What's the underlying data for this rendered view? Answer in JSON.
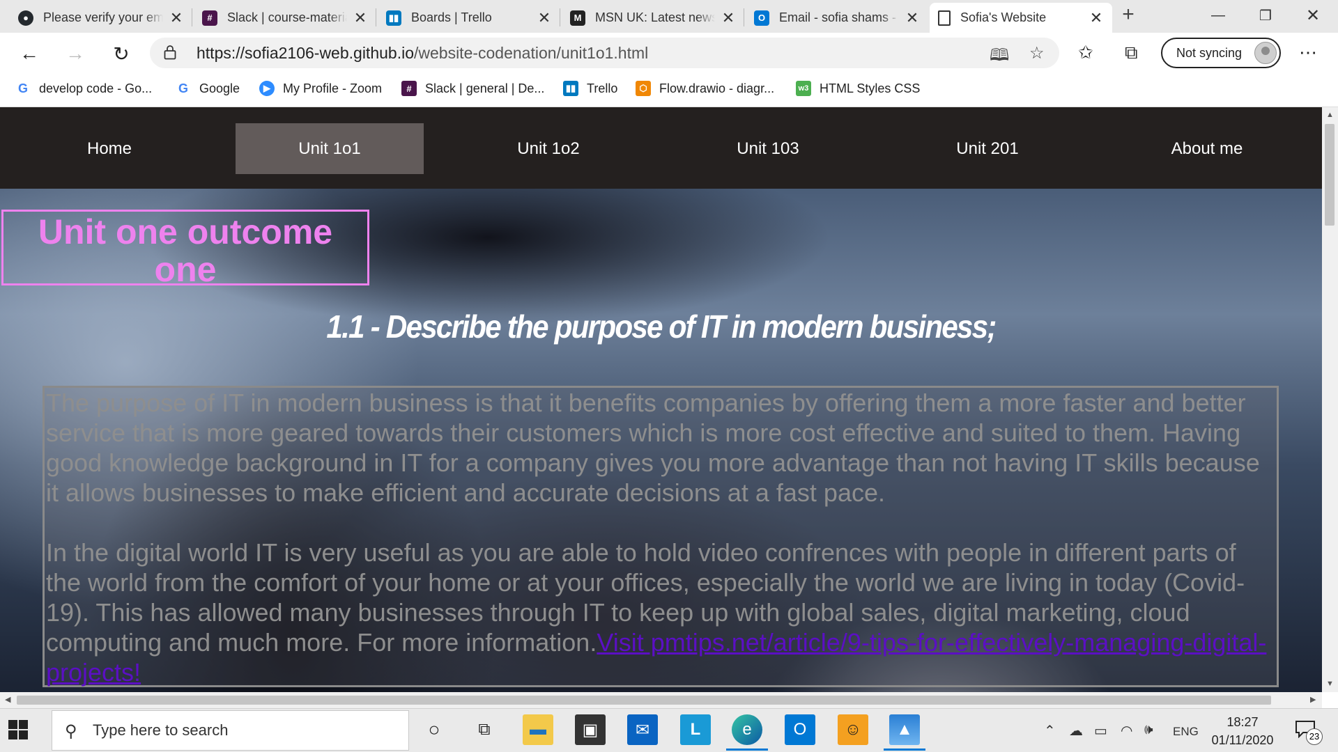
{
  "browser": {
    "tabs": [
      {
        "title": "Please verify your email",
        "icon": "github-icon",
        "favcolor": "#24292e",
        "glyph": "●"
      },
      {
        "title": "Slack | course-materials",
        "icon": "slack-icon",
        "favcolor": "#4a154b",
        "glyph": "#"
      },
      {
        "title": "Boards | Trello",
        "icon": "trello-icon",
        "favcolor": "#0079bf",
        "glyph": "▮"
      },
      {
        "title": "MSN UK: Latest news",
        "icon": "msn-icon",
        "favcolor": "#222222",
        "glyph": "M"
      },
      {
        "title": "Email - sofia shams - Outlook",
        "icon": "outlook-icon",
        "favcolor": "#0078d4",
        "glyph": "O"
      },
      {
        "title": "Sofia's Website",
        "icon": "page-icon",
        "favcolor": "#ffffff",
        "glyph": "🗋",
        "active": true
      }
    ],
    "url_host": "https://sofia2106-web.github.io",
    "url_path": "/website-codenation/unit1o1.html",
    "sync_label": "Not syncing",
    "favorites": [
      {
        "label": "develop code - Go...",
        "icon": "google-icon",
        "favcolor": "#4285f4",
        "glyph": "G"
      },
      {
        "label": "Google",
        "icon": "google-icon",
        "favcolor": "#4285f4",
        "glyph": "G"
      },
      {
        "label": "My Profile - Zoom",
        "icon": "zoom-icon",
        "favcolor": "#2d8cff",
        "glyph": "▶"
      },
      {
        "label": "Slack | general | De...",
        "icon": "slack-icon",
        "favcolor": "#4a154b",
        "glyph": "#"
      },
      {
        "label": "Trello",
        "icon": "trello-icon",
        "favcolor": "#0079bf",
        "glyph": "▮"
      },
      {
        "label": "Flow.drawio - diagr...",
        "icon": "drawio-icon",
        "favcolor": "#f08705",
        "glyph": "⬡"
      },
      {
        "label": "HTML Styles CSS",
        "icon": "w3schools-icon",
        "favcolor": "#4caf50",
        "glyph": "w3"
      }
    ]
  },
  "site": {
    "nav": [
      {
        "label": "Home"
      },
      {
        "label": "Unit 1o1",
        "active": true
      },
      {
        "label": "Unit 1o2"
      },
      {
        "label": "Unit 103"
      },
      {
        "label": "Unit 201"
      },
      {
        "label": "About me"
      }
    ],
    "heading": "Unit one outcome one",
    "subtitle": "1.1 - Describe the purpose of IT in modern business;",
    "paragraph1": "The purpose of IT in modern business is that it benefits companies by offering them a more faster and better service that is more geared towards their customers which is more cost effective and suited to them. Having good knowledge background in IT for a company gives you more advantage than not having IT skills because it allows businesses to make efficient and accurate decisions at a fast pace.",
    "paragraph2": "In the digital world IT is very useful as you are able to hold video confrences with people in different parts of the world from the comfort of your home or at your offices, especially the world we are living in today (Covid-19). This has allowed many businesses through IT to keep up with global sales, digital marketing, cloud computing and much more. For more information.",
    "link_text": "Visit pmtips.net/article/9-tips-for-effectively-managing-digital-projects!",
    "colors": {
      "heading": "#ee82ee",
      "nav_bg": "#24201f",
      "nav_active": "#625b5a",
      "link": "#5b0fc4"
    }
  },
  "taskbar": {
    "search_placeholder": "Type here to search",
    "apps": [
      "cortana-icon",
      "task-view-icon",
      "file-explorer-icon",
      "store-icon",
      "mail-icon",
      "app-l-icon",
      "edge-icon",
      "outlook-icon",
      "chrome-dev-icon",
      "photos-icon"
    ],
    "language": "ENG",
    "time": "18:27",
    "date": "01/11/2020",
    "notification_count": "23"
  }
}
